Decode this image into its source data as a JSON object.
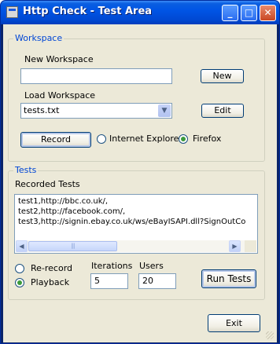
{
  "window": {
    "title": "Http Check - Test Area",
    "controls": {
      "minimize": "_",
      "maximize": "□",
      "close": "✕"
    }
  },
  "workspace": {
    "group_label": "Workspace",
    "new_label": "New Workspace",
    "new_value": "",
    "new_button": "New",
    "load_label": "Load Workspace",
    "load_value": "tests.txt",
    "edit_button": "Edit",
    "record_button": "Record",
    "browsers": [
      {
        "label": "Internet Explorer",
        "selected": false
      },
      {
        "label": "Firefox",
        "selected": true
      }
    ]
  },
  "tests": {
    "group_label": "Tests",
    "recorded_label": "Recorded Tests",
    "lines": [
      "test1,http://bbc.co.uk/,",
      "test2,http://facebook.com/,",
      "test3,http://signin.ebay.co.uk/ws/eBayISAPI.dll?SignOutCo"
    ],
    "modes": [
      {
        "label": "Re-record",
        "selected": false
      },
      {
        "label": "Playback",
        "selected": true
      }
    ],
    "iterations_label": "Iterations",
    "iterations_value": "5",
    "users_label": "Users",
    "users_value": "20",
    "run_button": "Run Tests"
  },
  "exit_button": "Exit",
  "icons": {
    "combo_arrow": "▼",
    "scroll_left": "◀",
    "scroll_right": "▶",
    "scroll_grip": "|||"
  }
}
